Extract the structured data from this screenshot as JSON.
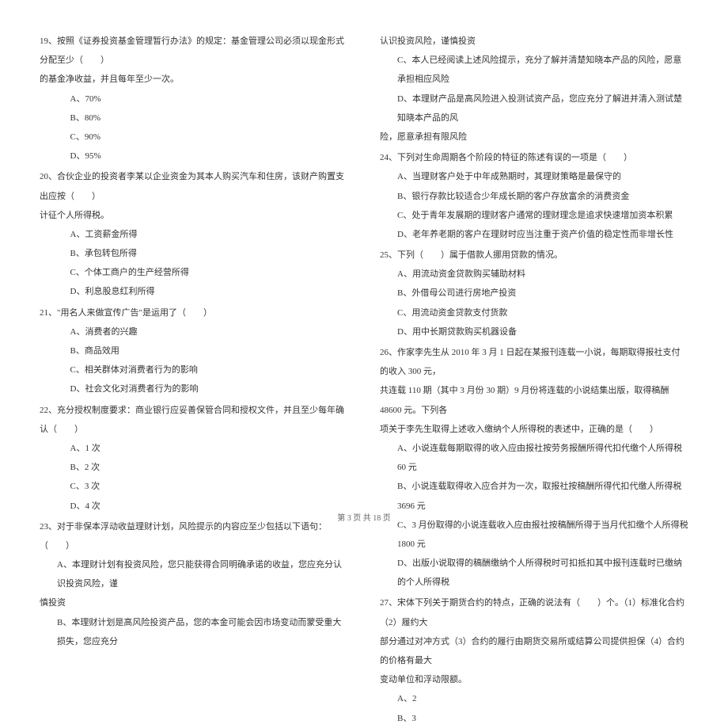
{
  "left": {
    "q19": {
      "text": "19、按照《证券投资基金管理暂行办法》的规定：基金管理公司必须以现金形式分配至少（　　）",
      "cont": "的基金净收益，并且每年至少一次。",
      "a": "A、70%",
      "b": "B、80%",
      "c": "C、90%",
      "d": "D、95%"
    },
    "q20": {
      "text": "20、合伙企业的投资者李某以企业资金为其本人购买汽车和住房，该财产购置支出应按（　　）",
      "cont": "计征个人所得税。",
      "a": "A、工资薪金所得",
      "b": "B、承包转包所得",
      "c": "C、个体工商户的生产经营所得",
      "d": "D、利息股息红利所得"
    },
    "q21": {
      "text": "21、\"用名人来做宣传广告\"是运用了（　　）",
      "a": "A、消费者的兴趣",
      "b": "B、商品效用",
      "c": "C、相关群体对消费者行为的影响",
      "d": "D、社会文化对消费者行为的影响"
    },
    "q22": {
      "text": "22、充分授权制度要求：商业银行应妥善保管合同和授权文件，并且至少每年确认（　　）",
      "a": "A、1 次",
      "b": "B、2 次",
      "c": "C、3 次",
      "d": "D、4 次"
    },
    "q23": {
      "text": "23、对于非保本浮动收益理财计划，风险提示的内容应至少包括以下语句：（　　）",
      "a": "A、本理财计划有投资风险，您只能获得合同明确承诺的收益，您应充分认识投资风险，谨",
      "acont": "慎投资",
      "b": "B、本理财计划是高风险投资产品，您的本金可能会因市场变动而蒙受重大损失，您应充分"
    }
  },
  "right": {
    "q23c": {
      "text": "认识投资风险，谨慎投资",
      "c": "C、本人已经阅读上述风险提示，充分了解并清楚知晓本产品的风险，愿意承担相应风险",
      "d": "D、本理财产品是高风险进入投测试资产品，您应充分了解进并清入测试楚知晓本产品的风",
      "dcont": "险，愿意承担有限风险"
    },
    "q24": {
      "text": "24、下列对生命周期各个阶段的特征的陈述有误的一项是（　　）",
      "a": "A、当理财客户处于中年成熟期时，其理财策略是最保守的",
      "b": "B、银行存款比较适合少年成长期的客户存放富余的消费资金",
      "c": "C、处于青年发展期的理财客户通常的理财理念是追求快速增加资本积累",
      "d": "D、老年养老期的客户在理财时应当注重于资产价值的稳定性而非增长性"
    },
    "q25": {
      "text": "25、下列（　　）属于借款人挪用贷款的情况。",
      "a": "A、用流动资金贷款购买辅助材料",
      "b": "B、外借母公司进行房地产投资",
      "c": "C、用流动资金贷款支付货款",
      "d": "D、用中长期贷款购买机器设备"
    },
    "q26": {
      "text": "26、作家李先生从 2010 年 3 月 1 日起在某报刊连载一小说，每期取得报社支付的收入 300 元，",
      "cont1": "共连载 110 期（其中 3 月份 30 期）9 月份将连载的小说结集出版，取得稿酬 48600 元。下列各",
      "cont2": "项关于李先生取得上述收入缴纳个人所得税的表述中，正确的是（　　）",
      "a": "A、小说连载每期取得的收入应由报社按劳务报酬所得代扣代缴个人所得税 60 元",
      "b": "B、小说连载取得收入应合并为一次，取报社按稿酬所得代扣代缴人所得税 3696 元",
      "c": "C、3 月份取得的小说连载收入应由报社按稿酬所得于当月代扣缴个人所得税 1800 元",
      "d": "D、出版小说取得的稿酬缴纳个人所得税时可扣抵扣其中报刊连载时已缴纳的个人所得税"
    },
    "q27": {
      "text": "27、宋体下列关于期货合约的特点，正确的说法有（　　）个。（1）标准化合约（2）履约大",
      "cont1": "部分通过对冲方式（3）合约的履行由期货交易所或结算公司提供担保（4）合约的价格有最大",
      "cont2": "变动单位和浮动限额。",
      "a": "A、2",
      "b": "B、3"
    }
  },
  "footer": "第 3 页 共 18 页"
}
